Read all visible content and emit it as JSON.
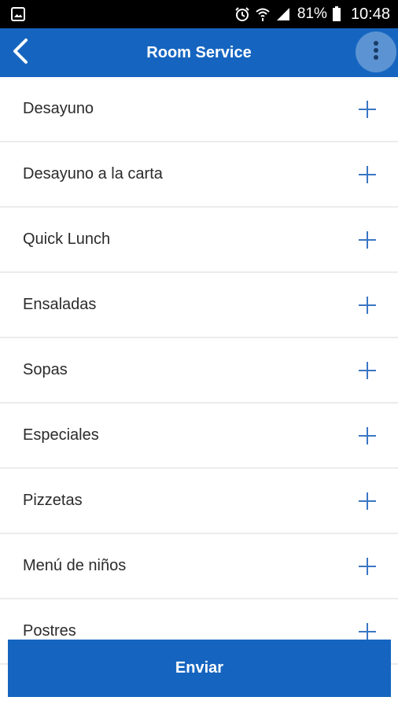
{
  "status_bar": {
    "battery": "81%",
    "time": "10:48",
    "left_icon": "gallery-icon",
    "right_icons": [
      "alarm-icon",
      "wifi-icon",
      "signal-icon",
      "battery-icon"
    ]
  },
  "app_bar": {
    "title": "Room Service",
    "back_icon": "back-arrow-icon",
    "menu_icon": "more-vert-icon",
    "color": "#1565c0"
  },
  "categories": [
    {
      "label": "Desayuno",
      "icon": "plus-icon"
    },
    {
      "label": "Desayuno a la carta",
      "icon": "plus-icon"
    },
    {
      "label": "Quick Lunch",
      "icon": "plus-icon"
    },
    {
      "label": "Ensaladas",
      "icon": "plus-icon"
    },
    {
      "label": "Sopas",
      "icon": "plus-icon"
    },
    {
      "label": "Especiales",
      "icon": "plus-icon"
    },
    {
      "label": "Pizzetas",
      "icon": "plus-icon"
    },
    {
      "label": "Menú de niños",
      "icon": "plus-icon"
    },
    {
      "label": "Postres",
      "icon": "plus-icon"
    }
  ],
  "send_button": {
    "label": "Enviar"
  },
  "colors": {
    "accent": "#1565c0",
    "plus": "#3a76c4",
    "divider": "#ececec"
  }
}
